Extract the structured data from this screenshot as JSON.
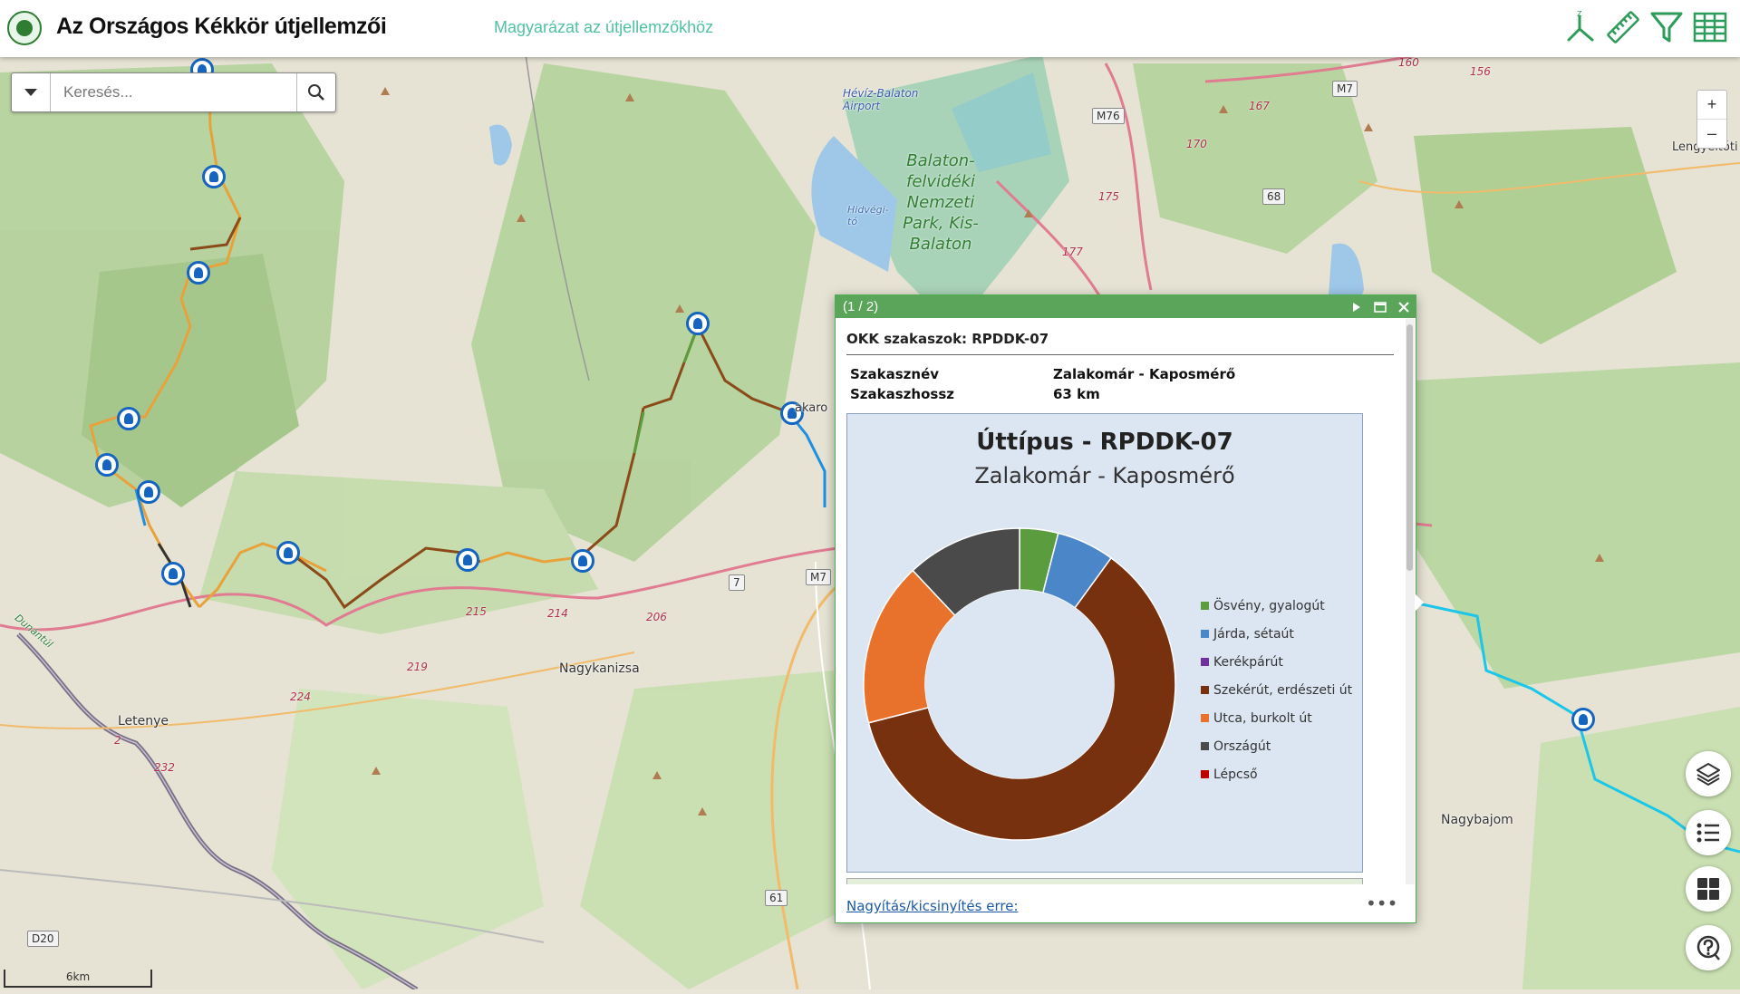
{
  "header": {
    "title": "Az Országos Kékkör útjellemzői",
    "help_link": "Magyarázat az útjellemzőkhöz",
    "tools": [
      "measure-axes-icon",
      "ruler-icon",
      "filter-icon",
      "table-icon"
    ]
  },
  "search": {
    "placeholder": "Keresés..."
  },
  "zoom": {
    "in_label": "+",
    "out_label": "–"
  },
  "map_labels": {
    "airport": "Hévíz-Balaton Airport",
    "hidvegi": "Hidvégi-tó",
    "park": "Balaton-\nfelvidéki\nNemzeti\nPark, Kis-\nBalaton",
    "lengyeltoti": "Lengyeltóti",
    "nagykanizsa": "Nagykanizsa",
    "letenye": "Letenye",
    "nagybajom": "Nagybajom",
    "zalakaros": "akaro",
    "dunantul": "Dunántúl"
  },
  "road_shields": [
    "M7",
    "M76",
    "68",
    "7",
    "M7",
    "61",
    "D20"
  ],
  "route_numbers": [
    "160",
    "156",
    "167",
    "170",
    "175",
    "177",
    "215",
    "214",
    "206",
    "219",
    "224",
    "232",
    "2"
  ],
  "scale_label": "6km",
  "popup": {
    "count": "(1 / 2)",
    "layer_title": "OKK szakaszok: RPDDK-07",
    "attributes": [
      {
        "key": "Szakasznév",
        "value": "Zalakomár - Kaposmérő"
      },
      {
        "key": "Szakaszhossz",
        "value": "63 km"
      }
    ],
    "zoom_link": "Nagyítás/kicsinyítés erre:",
    "more": "•••"
  },
  "chart_data": {
    "type": "pie",
    "title": "Úttípus - RPDDK-07",
    "subtitle": "Zalakomár - Kaposmérő",
    "categories": [
      "Ösvény, gyalogút",
      "Járda, sétaút",
      "Kerékpárút",
      "Szekérút, erdészeti út",
      "Utca, burkolt út",
      "Országút",
      "Lépcső"
    ],
    "values": [
      4,
      6,
      0,
      61,
      17,
      12,
      0
    ],
    "colors": [
      "#5b9c3e",
      "#4a86c8",
      "#7030a0",
      "#78310f",
      "#e8722c",
      "#4a4a4a",
      "#c00000"
    ],
    "legend_position": "right",
    "donut": true
  }
}
